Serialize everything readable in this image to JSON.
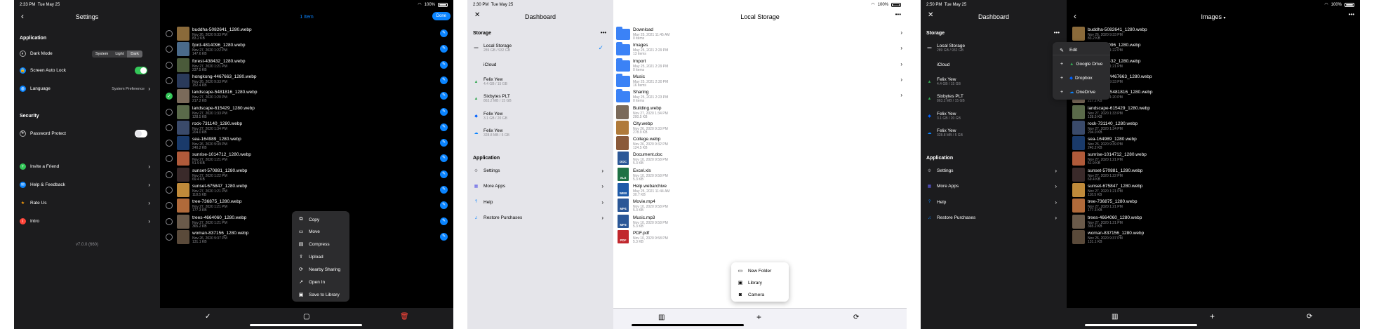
{
  "screen1": {
    "status": {
      "time": "2:33 PM",
      "date": "Tue May 25",
      "battery": "100%"
    },
    "settings_title": "Settings",
    "selection_title": "1 Item",
    "done_label": "Done",
    "application_header": "Application",
    "dark_mode_label": "Dark Mode",
    "segments": [
      "System",
      "Light",
      "Dark"
    ],
    "screen_auto_lock_label": "Screen Auto Lock",
    "language_label": "Language",
    "language_value": "System Preference",
    "security_header": "Security",
    "password_protect_label": "Password Protect",
    "links": [
      "Invite a Friend",
      "Help & Feedback",
      "Rate Us",
      "Intro"
    ],
    "version": "v7.0.0 (660)",
    "menu": [
      "Copy",
      "Move",
      "Compress",
      "Upload",
      "Nearby Sharing",
      "Open In",
      "Save to Library"
    ]
  },
  "files_a": [
    {
      "name": "buddha-5082641_1280.webp",
      "date": "Nov 26, 2020 9:33 PM",
      "size": "83.2 KB",
      "color": "#8a6a3a"
    },
    {
      "name": "fjord-4814096_1280.webp",
      "date": "Nov 27, 2020 1:22 PM",
      "size": "147.6 KB",
      "color": "#4a6a8a"
    },
    {
      "name": "forest-438432_1280.webp",
      "date": "Nov 27, 2020 1:21 PM",
      "size": "237.5 KB",
      "color": "#4a5a3a"
    },
    {
      "name": "hongkong-4467663_1280.webp",
      "date": "Nov 26, 2020 9:33 PM",
      "size": "152.4 KB",
      "color": "#2a3a5a"
    },
    {
      "name": "landscape-5481816_1280.webp",
      "date": "Nov 27, 2020 1:20 PM",
      "size": "217.2 KB",
      "color": "#7a6a5a"
    },
    {
      "name": "landscape-615429_1280.webp",
      "date": "Nov 27, 2020 1:33 PM",
      "size": "128.5 KB",
      "color": "#5a6a4a"
    },
    {
      "name": "rock-731140_1280.webp",
      "date": "Nov 27, 2020 1:34 PM",
      "size": "204.0 KB",
      "color": "#3a4a6a"
    },
    {
      "name": "sea-164989_1280.webp",
      "date": "Nov 26, 2020 9:39 PM",
      "size": "240.2 KB",
      "color": "#1a3a6a"
    },
    {
      "name": "sunrise-1014712_1280.webp",
      "date": "Nov 27, 2020 1:21 PM",
      "size": "51.9 KB",
      "color": "#b05a3a"
    },
    {
      "name": "sunset-570881_1280.webp",
      "date": "Nov 27, 2020 1:22 PM",
      "size": "69.4 KB",
      "color": "#3a2a2a"
    },
    {
      "name": "sunset-675847_1280.webp",
      "date": "Nov 27, 2020 1:21 PM",
      "size": "118.5 KB",
      "color": "#c08a3a"
    },
    {
      "name": "tree-736875_1280.webp",
      "date": "Nov 27, 2020 1:21 PM",
      "size": "177.3 KB",
      "color": "#b06a3a"
    },
    {
      "name": "trees-4664060_1280.webp",
      "date": "Nov 27, 2020 1:21 PM",
      "size": "365.2 KB",
      "color": "#6a5a4a"
    },
    {
      "name": "woman-837156_1280.webp",
      "date": "Nov 26, 2020 9:37 PM",
      "size": "131.1 KB",
      "color": "#5a4a3a"
    }
  ],
  "screen2": {
    "status": {
      "time": "2:30 PM",
      "date": "Tue May 25",
      "battery": "100%"
    },
    "dashboard_title": "Dashboard",
    "local_storage_title": "Local Storage",
    "storage_header": "Storage",
    "application_header": "Application",
    "storage_items": [
      {
        "name": "Local Storage",
        "sub": "289 GB / 932 GB",
        "icon": "drive-icon"
      },
      {
        "name": "iCloud",
        "sub": "",
        "icon": "apple-icon"
      },
      {
        "name": "Felix Yew",
        "sub": "4.4 GB / 15 GB",
        "icon": "google-drive-icon"
      },
      {
        "name": "Sixbytes PLT",
        "sub": "863.2 MB / 15 GB",
        "icon": "google-drive-icon"
      },
      {
        "name": "Felix Yew",
        "sub": "3.1 GB / 20 GB",
        "icon": "dropbox-icon"
      },
      {
        "name": "Felix Yew",
        "sub": "328.8 MB / 5 GB",
        "icon": "onedrive-icon"
      }
    ],
    "app_items": [
      "Settings",
      "More Apps",
      "Help",
      "Restore Purchases"
    ],
    "files": [
      {
        "name": "Download",
        "date": "May 25, 2021 11:45 AM",
        "size": "0 items",
        "kind": "folder"
      },
      {
        "name": "Images",
        "date": "May 25, 2021 2:29 PM",
        "size": "13 items",
        "kind": "folder"
      },
      {
        "name": "Import",
        "date": "May 25, 2021 2:29 PM",
        "size": "0 items",
        "kind": "folder"
      },
      {
        "name": "Music",
        "date": "May 25, 2021 2:30 PM",
        "size": "16 items",
        "kind": "folder"
      },
      {
        "name": "Sharing",
        "date": "May 25, 2021 2:23 PM",
        "size": "0 items",
        "kind": "folder"
      },
      {
        "name": "Building.webp",
        "date": "Nov 27, 2020 1:34 PM",
        "size": "200.5 KB",
        "kind": "image",
        "color": "#7a6a5a"
      },
      {
        "name": "City.webp",
        "date": "Nov 26, 2020 9:33 PM",
        "size": "278.9 KB",
        "color": "#b07a3a",
        "kind": "image"
      },
      {
        "name": "College.webp",
        "date": "Nov 26, 2020 9:32 PM",
        "size": "124.5 KB",
        "color": "#8a5a3a",
        "kind": "image"
      },
      {
        "name": "Document.doc",
        "date": "Nov 10, 2020 9:58 PM",
        "size": "5.3 KB",
        "kind": "doc",
        "badge": "DOC",
        "color": "#2b5797"
      },
      {
        "name": "Excel.xls",
        "date": "Nov 10, 2020 9:58 PM",
        "size": "5.3 KB",
        "kind": "doc",
        "badge": "XLS",
        "color": "#1e7145"
      },
      {
        "name": "Help.webarchive",
        "date": "May 25, 2021 11:44 AM",
        "size": "30.7 KB",
        "kind": "doc",
        "badge": "WEB",
        "color": "#1e5aa8"
      },
      {
        "name": "Movie.mp4",
        "date": "Nov 10, 2020 9:58 PM",
        "size": "5.3 KB",
        "kind": "doc",
        "badge": "MP4",
        "color": "#2b5797"
      },
      {
        "name": "Music.mp3",
        "date": "Nov 10, 2020 9:58 PM",
        "size": "5.3 KB",
        "kind": "doc",
        "badge": "MP3",
        "color": "#2b5797"
      },
      {
        "name": "PDF.pdf",
        "date": "Nov 10, 2020 9:58 PM",
        "size": "5.3 KB",
        "kind": "doc",
        "badge": "PDF",
        "color": "#c1272d"
      }
    ],
    "menu": [
      "New Folder",
      "Library",
      "Camera"
    ]
  },
  "screen3": {
    "status": {
      "time": "2:50 PM",
      "date": "Tue May 25",
      "battery": "100%"
    },
    "dashboard_title": "Dashboard",
    "images_title": "Images",
    "storage_header": "Storage",
    "application_header": "Application",
    "menu": [
      "Edit",
      "Google Drive",
      "Dropbox",
      "OneDrive"
    ]
  }
}
